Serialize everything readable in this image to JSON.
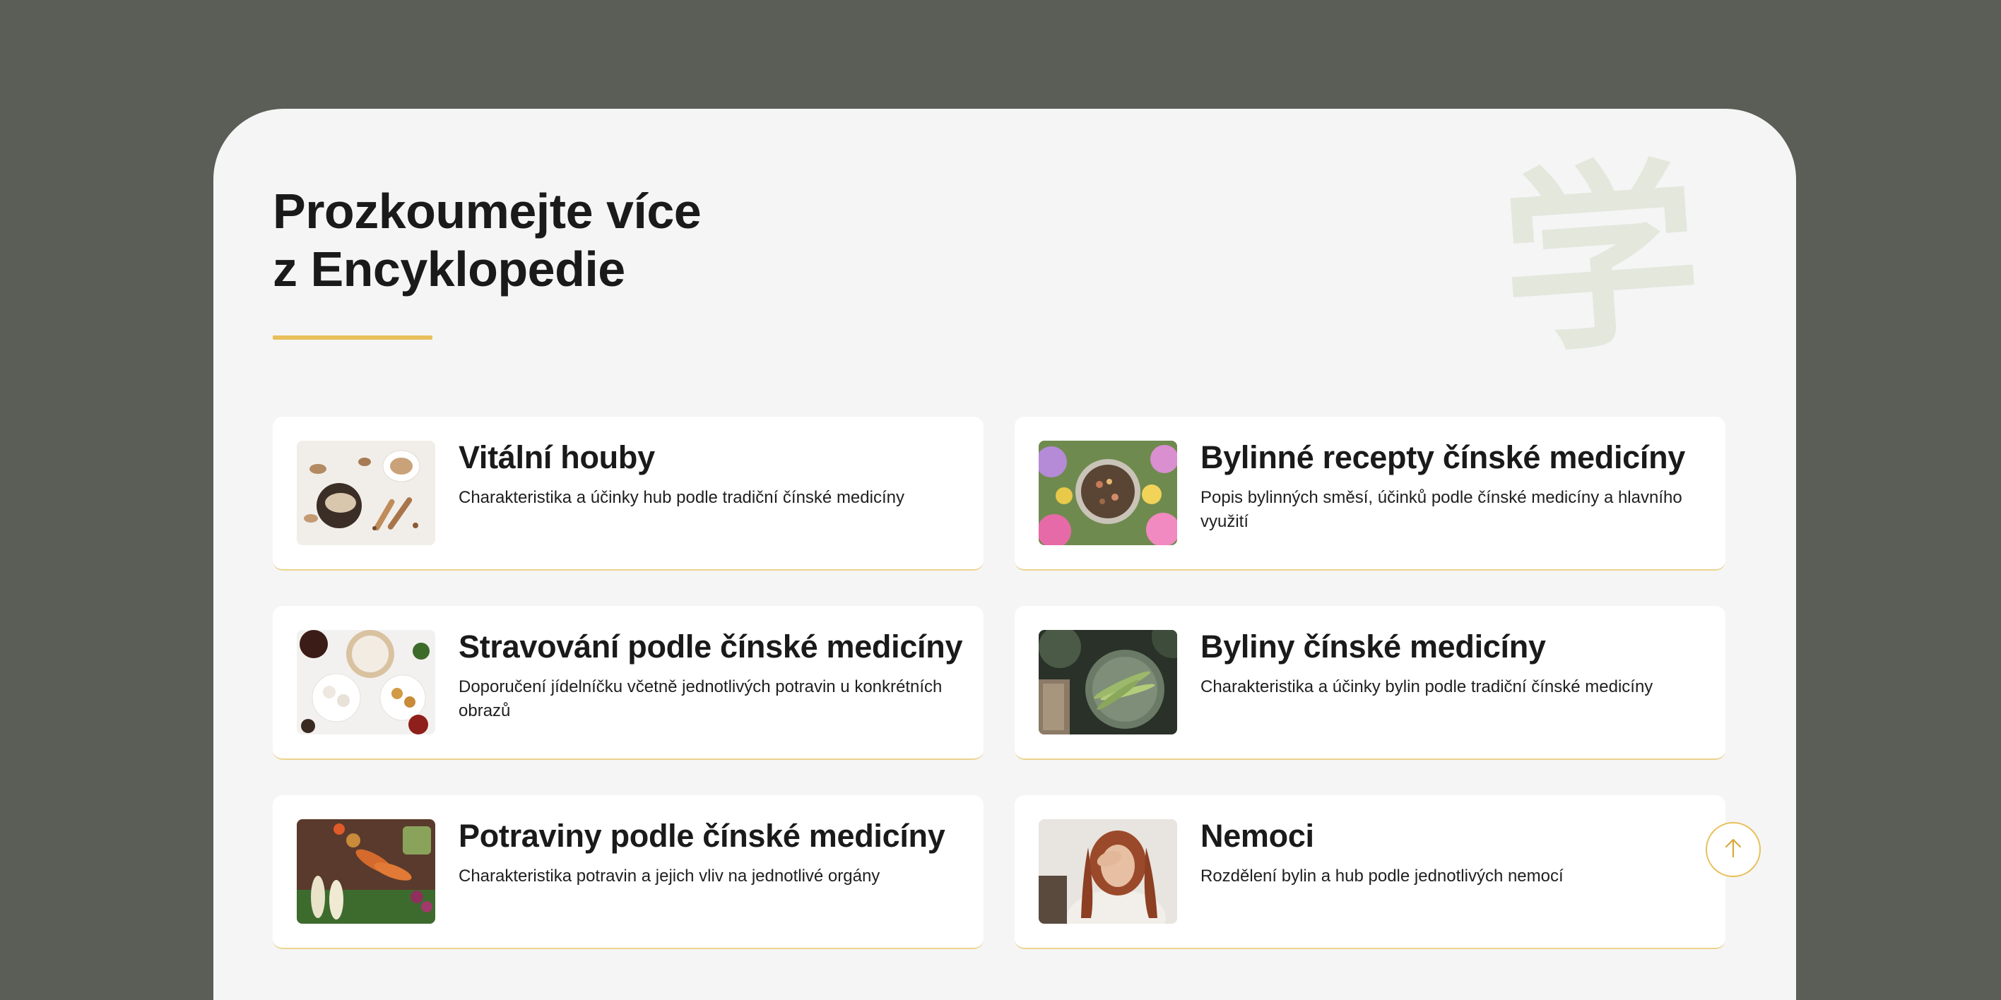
{
  "section": {
    "heading_line1": "Prozkoumejte více",
    "heading_line2": "z Encyklopedie",
    "watermark_char": "学"
  },
  "cards": [
    {
      "title": "Vitální houby",
      "description": "Charakteristika a účinky hub podle tradiční čínské medicíny",
      "image": "mushrooms-photo"
    },
    {
      "title": "Bylinné recepty čínské medicíny",
      "description": "Popis bylinných směsí, účinků podle čínské medicíny a hlavního využití",
      "image": "herbal-tea-flowers-photo"
    },
    {
      "title": "Stravování podle čínské medicíny",
      "description": "Doporučení jídelníčku včetně jednotlivých potravin u konkrétních obrazů",
      "image": "dim-sum-dishes-photo"
    },
    {
      "title": "Byliny čínské medicíny",
      "description": "Charakteristika a účinky bylin podle tradiční čínské medicíny",
      "image": "herb-plate-photo"
    },
    {
      "title": "Potraviny podle čínské medicíny",
      "description": "Charakteristika potravin a jejich vliv na jednotlivé orgány",
      "image": "vegetables-photo"
    },
    {
      "title": "Nemoci",
      "description": "Rozdělení bylin a hub podle jednotlivých nemocí",
      "image": "tired-woman-photo"
    }
  ],
  "scroll_top": {
    "icon": "arrow-up-icon"
  },
  "colors": {
    "outer_background": "#5b5e56",
    "panel_background": "#f5f5f5",
    "accent": "#e8c05b",
    "watermark": "#e3e7dc"
  }
}
